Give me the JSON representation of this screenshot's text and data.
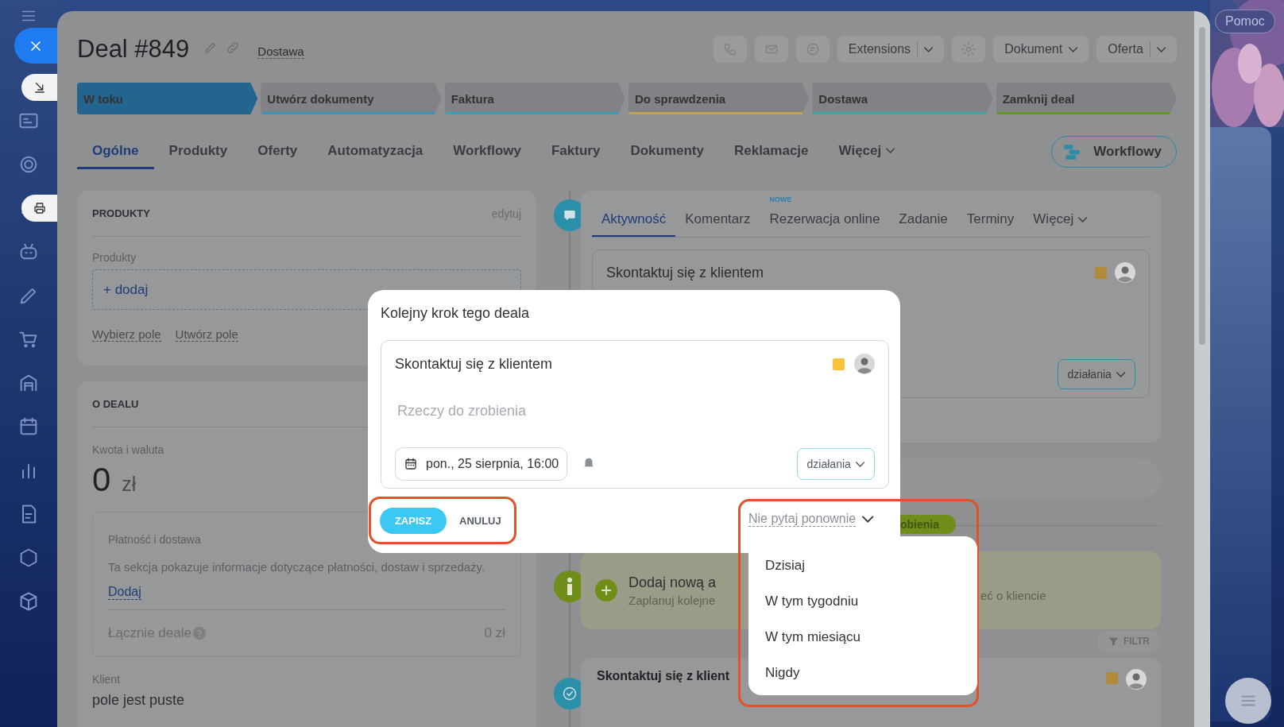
{
  "help_label": "Pomoc",
  "deal": {
    "title": "Deal #849",
    "stage_select": "Dostawa"
  },
  "toolbar": {
    "extensions": "Extensions",
    "document": "Dokument",
    "offer": "Oferta"
  },
  "stages": [
    {
      "label": "W toku",
      "selected": true,
      "color": "#23658f"
    },
    {
      "label": "Utwórz dokumenty",
      "selected": false,
      "color": "#3b93b8"
    },
    {
      "label": "Faktura",
      "selected": false,
      "color": "#3aa0b8"
    },
    {
      "label": "Do sprawdzenia",
      "selected": false,
      "color": "#c4a24a"
    },
    {
      "label": "Dostawa",
      "selected": false,
      "color": "#3aa89a"
    },
    {
      "label": "Zamknij deal",
      "selected": false,
      "color": "#5f9a1c"
    }
  ],
  "tabs": [
    {
      "label": "Ogólne",
      "selected": true
    },
    {
      "label": "Produkty",
      "selected": false
    },
    {
      "label": "Oferty",
      "selected": false
    },
    {
      "label": "Automatyzacja",
      "selected": false
    },
    {
      "label": "Workflowy",
      "selected": false
    },
    {
      "label": "Faktury",
      "selected": false
    },
    {
      "label": "Dokumenty",
      "selected": false
    },
    {
      "label": "Reklamacje",
      "selected": false
    },
    {
      "label": "Więcej",
      "selected": false
    }
  ],
  "workflow_button": "Workflowy",
  "products_card": {
    "title": "PRODUKTY",
    "edit": "edytuj",
    "field_label": "Produkty",
    "add": "+ dodaj",
    "links": [
      "Wybierz pole",
      "Utwórz pole"
    ]
  },
  "deal_card": {
    "title": "O DEALU",
    "amount_label": "Kwota i waluta",
    "amount": "0",
    "currency": "zł",
    "payment": {
      "title": "Płatność i dostawa",
      "text": "Ta sekcja pokazuje informacje dotyczące płatności, dostaw i sprzedaży.",
      "link": "Dodaj",
      "total_label": "Łącznie deale",
      "total": "0 zł"
    },
    "client_label": "Klient",
    "client_value": "pole jest puste"
  },
  "activity": {
    "tabs": [
      {
        "label": "Aktywność",
        "selected": true
      },
      {
        "label": "Komentarz",
        "selected": false
      },
      {
        "label": "Rezerwacja online",
        "selected": false,
        "badge": "NOWE"
      },
      {
        "label": "Zadanie",
        "selected": false
      },
      {
        "label": "Terminy",
        "selected": false
      },
      {
        "label": "Więcej",
        "selected": false
      }
    ],
    "task": {
      "title": "Skontaktuj się z klientem",
      "action": "działania"
    },
    "status_badge": "obienia",
    "prompt": {
      "title": "Dodaj nową a",
      "subtitle": "Zaplanuj kolejne",
      "subtitle_end": "eć o kliencie"
    },
    "filter": "FILTR",
    "history": {
      "title": "Skontaktuj się z klient"
    }
  },
  "dialog": {
    "title": "Kolejny krok tego deala",
    "task_title": "Skontaktuj się z klientem",
    "placeholder": "Rzeczy do zrobienia",
    "date": "pon., 25 sierpnia, 16:00",
    "action": "działania",
    "save": "ZAPISZ",
    "cancel": "ANULUJ",
    "dont_ask": "Nie pytaj ponownie",
    "options": [
      "Dzisiaj",
      "W tym tygodniu",
      "W tym miesiącu",
      "Nigdy"
    ]
  }
}
